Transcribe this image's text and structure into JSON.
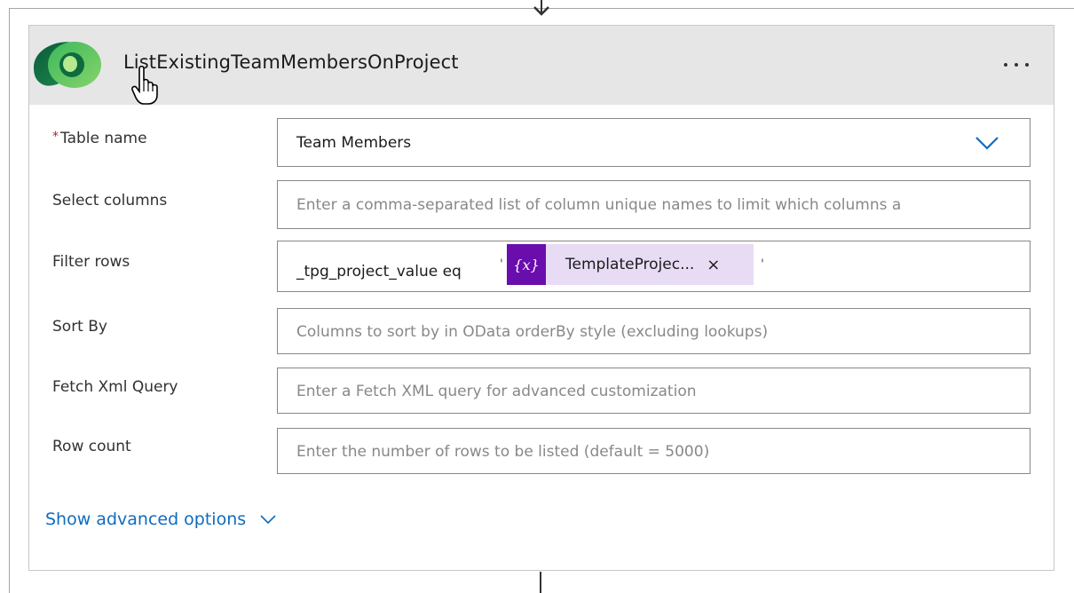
{
  "card": {
    "title": "ListExistingTeamMembersOnProject",
    "menu_icon": "more-horizontal-icon",
    "logo_icon": "dataverse-logo-icon"
  },
  "fields": {
    "table_name": {
      "label": "Table name",
      "required_mark": "*",
      "value": "Team Members",
      "icon": "chevron-down-icon"
    },
    "select_columns": {
      "label": "Select columns",
      "placeholder": "Enter a comma-separated list of column unique names to limit which columns a"
    },
    "filter_rows": {
      "label": "Filter rows",
      "prefix": "_tpg_project_value eq",
      "open_quote": "'",
      "close_quote": "'",
      "token": {
        "icon_text": "{x}",
        "text": "TemplateProjec...",
        "close": "×"
      }
    },
    "sort_by": {
      "label": "Sort By",
      "placeholder": "Columns to sort by in OData orderBy style (excluding lookups)"
    },
    "fetch_xml": {
      "label": "Fetch Xml Query",
      "placeholder": "Enter a Fetch XML query for advanced customization"
    },
    "row_count": {
      "label": "Row count",
      "placeholder": "Enter the number of rows to be listed (default = 5000)"
    }
  },
  "advanced": {
    "label": "Show advanced options"
  },
  "colors": {
    "accent": "#0f6cbd",
    "token_bg": "#e8dcf5",
    "token_icon_bg": "#6a0dad",
    "required": "#a4262c"
  }
}
